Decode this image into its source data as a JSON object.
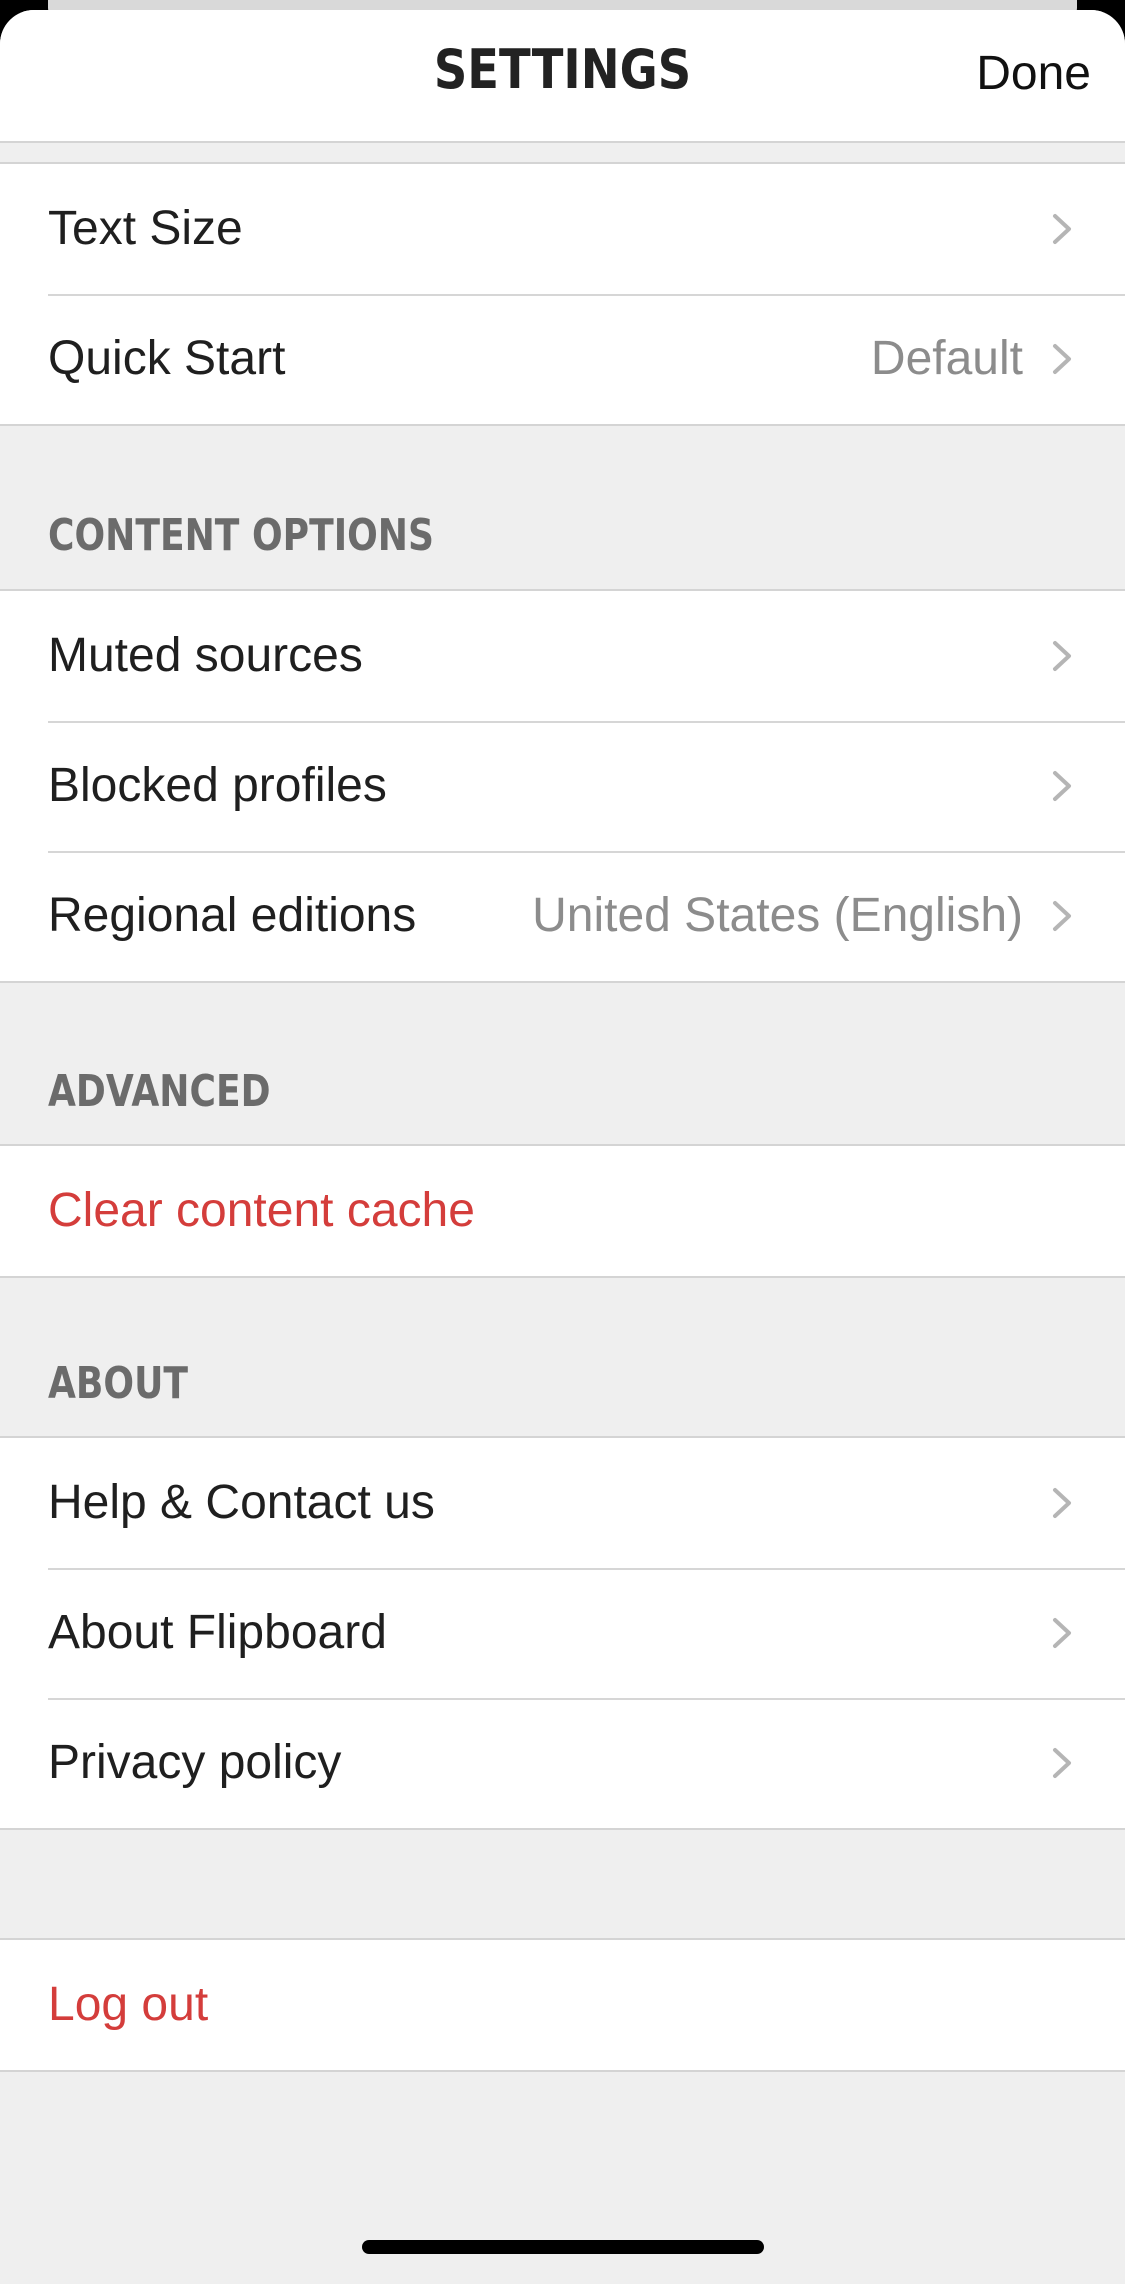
{
  "nav": {
    "title": "SETTINGS",
    "done_label": "Done"
  },
  "group_top": {
    "items": [
      {
        "label": "Text Size",
        "value": ""
      },
      {
        "label": "Quick Start",
        "value": "Default"
      }
    ]
  },
  "content_options": {
    "header": "CONTENT OPTIONS",
    "items": [
      {
        "label": "Muted sources",
        "value": ""
      },
      {
        "label": "Blocked profiles",
        "value": ""
      },
      {
        "label": "Regional editions",
        "value": "United States (English)"
      }
    ]
  },
  "advanced": {
    "header": "ADVANCED",
    "items": [
      {
        "label": "Clear content cache"
      }
    ]
  },
  "about": {
    "header": "ABOUT",
    "items": [
      {
        "label": "Help & Contact us"
      },
      {
        "label": "About Flipboard"
      },
      {
        "label": "Privacy policy"
      }
    ]
  },
  "logout": {
    "label": "Log out"
  },
  "colors": {
    "danger": "#d43d3b",
    "secondary_text": "#8c8c8c",
    "background": "#efefef"
  },
  "icons": {
    "disclosure": "chevron-right-icon"
  }
}
